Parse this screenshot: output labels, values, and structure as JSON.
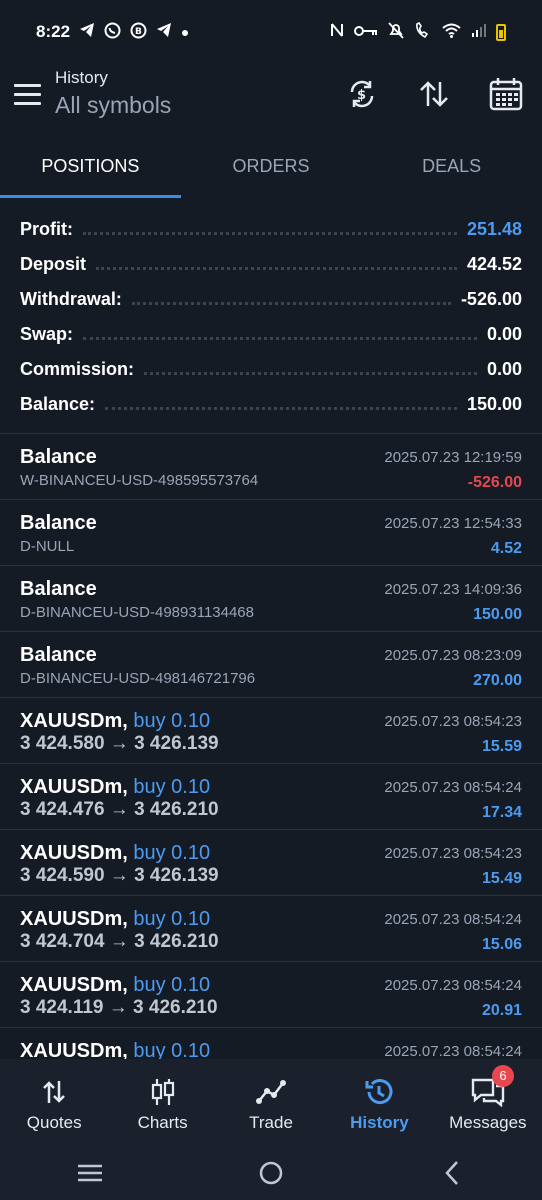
{
  "status_bar": {
    "time": "8:22"
  },
  "header": {
    "section": "History",
    "filter": "All symbols"
  },
  "tabs": [
    {
      "label": "POSITIONS",
      "active": true
    },
    {
      "label": "ORDERS",
      "active": false
    },
    {
      "label": "DEALS",
      "active": false
    }
  ],
  "summary": {
    "profit_label": "Profit:",
    "profit_value": "251.48",
    "deposit_label": "Deposit",
    "deposit_value": "424.52",
    "withdrawal_label": "Withdrawal:",
    "withdrawal_value": "-526.00",
    "swap_label": "Swap:",
    "swap_value": "0.00",
    "commission_label": "Commission:",
    "commission_value": "0.00",
    "balance_label": "Balance:",
    "balance_value": "150.00"
  },
  "deals": [
    {
      "title": "Balance",
      "buy": "",
      "sub": "W-BINANCEU-USD-498595573764",
      "date": "2025.07.23 12:19:59",
      "amount": "-526.00",
      "negative": true
    },
    {
      "title": "Balance",
      "buy": "",
      "sub": "D-NULL",
      "date": "2025.07.23 12:54:33",
      "amount": "4.52",
      "negative": false
    },
    {
      "title": "Balance",
      "buy": "",
      "sub": "D-BINANCEU-USD-498931134468",
      "date": "2025.07.23 14:09:36",
      "amount": "150.00",
      "negative": false
    },
    {
      "title": "Balance",
      "buy": "",
      "sub": "D-BINANCEU-USD-498146721796",
      "date": "2025.07.23 08:23:09",
      "amount": "270.00",
      "negative": false
    },
    {
      "title": "XAUUSDm,",
      "buy": "buy 0.10",
      "sub": "3 424.580 → 3 426.139",
      "date": "2025.07.23 08:54:23",
      "amount": "15.59",
      "negative": false
    },
    {
      "title": "XAUUSDm,",
      "buy": "buy 0.10",
      "sub": "3 424.476 → 3 426.210",
      "date": "2025.07.23 08:54:24",
      "amount": "17.34",
      "negative": false
    },
    {
      "title": "XAUUSDm,",
      "buy": "buy 0.10",
      "sub": "3 424.590 → 3 426.139",
      "date": "2025.07.23 08:54:23",
      "amount": "15.49",
      "negative": false
    },
    {
      "title": "XAUUSDm,",
      "buy": "buy 0.10",
      "sub": "3 424.704 → 3 426.210",
      "date": "2025.07.23 08:54:24",
      "amount": "15.06",
      "negative": false
    },
    {
      "title": "XAUUSDm,",
      "buy": "buy 0.10",
      "sub": "3 424.119 → 3 426.210",
      "date": "2025.07.23 08:54:24",
      "amount": "20.91",
      "negative": false
    },
    {
      "title": "XAUUSDm,",
      "buy": "buy 0.10",
      "sub": "",
      "date": "2025.07.23 08:54:24",
      "amount": "",
      "negative": false
    }
  ],
  "bottom_nav": {
    "quotes": "Quotes",
    "charts": "Charts",
    "trade": "Trade",
    "history": "History",
    "messages": "Messages",
    "messages_badge": "6"
  },
  "colors": {
    "background": "#151b25",
    "accent": "#4d9bf0",
    "negative": "#e8474f"
  }
}
